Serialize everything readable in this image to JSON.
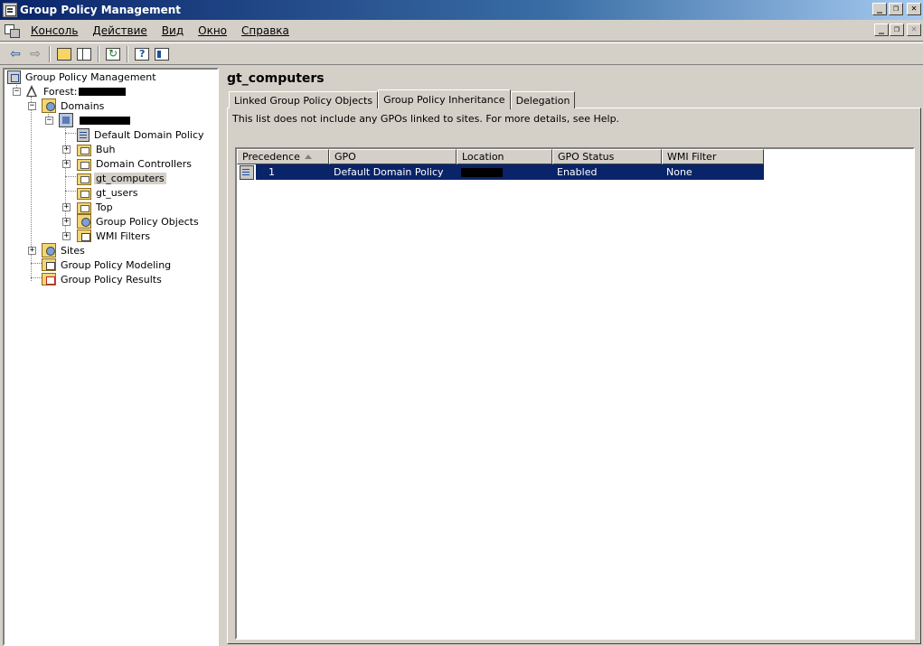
{
  "window": {
    "title": "Group Policy Management",
    "buttons": {
      "minimize": "_",
      "restore": "❐",
      "close": "✕"
    }
  },
  "menu": {
    "items": [
      {
        "label": "Консоль"
      },
      {
        "label": "Действие"
      },
      {
        "label": "Вид"
      },
      {
        "label": "Окно"
      },
      {
        "label": "Справка"
      }
    ]
  },
  "tree": {
    "root": "Group Policy Management",
    "forest": "Forest:",
    "domains": "Domains",
    "domain_items": [
      "Default Domain Policy",
      "Buh",
      "Domain Controllers",
      "gt_computers",
      "gt_users",
      "Top",
      "Group Policy Objects",
      "WMI Filters"
    ],
    "sites": "Sites",
    "modeling": "Group Policy Modeling",
    "results": "Group Policy Results"
  },
  "right": {
    "title": "gt_computers",
    "tabs": [
      "Linked Group Policy Objects",
      "Group Policy Inheritance",
      "Delegation"
    ],
    "active_tab": "Group Policy Inheritance",
    "info": "This list does not include any GPOs linked to sites. For more details, see Help.",
    "columns": [
      "Precedence",
      "GPO",
      "Location",
      "GPO Status",
      "WMI Filter"
    ],
    "rows": [
      {
        "precedence": "1",
        "gpo": "Default Domain Policy",
        "location": "",
        "status": "Enabled",
        "wmi": "None"
      }
    ]
  },
  "colors": {
    "selection": "#0a246a",
    "chrome": "#d4d0c8",
    "title_gradient_start": "#0a246a",
    "title_gradient_end": "#a6caf0"
  }
}
